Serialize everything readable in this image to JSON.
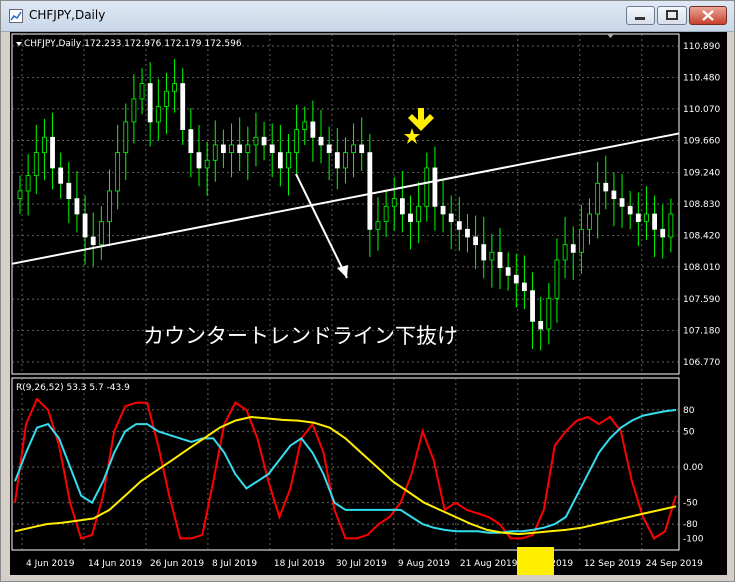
{
  "window": {
    "title": "CHFJPY,Daily",
    "min_icon": "minimize-icon",
    "max_icon": "maximize-icon",
    "close_icon": "close-icon"
  },
  "chart_header": {
    "symbol_line": "CHFJPY,Daily  172.233 172.976 172.179 172.596"
  },
  "annotation": {
    "text": "カウンタートレンドライン下抜け"
  },
  "oscillator": {
    "label": "R(9,26,52) 53.3 5.7 -43.9"
  },
  "colors": {
    "background": "#000000",
    "candle": "#00ff00",
    "trendline": "#ffffff",
    "osc_red": "#ff0000",
    "osc_cyan": "#33ddee",
    "osc_yellow": "#ffee00",
    "marker": "#ffee00"
  },
  "chart_data": [
    {
      "type": "candlestick",
      "title": "CHFJPY,Daily",
      "y_ticks": [
        "110.890",
        "110.480",
        "110.070",
        "109.660",
        "109.240",
        "108.830",
        "108.420",
        "108.010",
        "107.590",
        "107.180",
        "106.770"
      ],
      "ylim": [
        106.77,
        110.89
      ],
      "x_ticks": [
        "4 Jun 2019",
        "14 Jun 2019",
        "26 Jun 2019",
        "8 Jul 2019",
        "18 Jul 2019",
        "30 Jul 2019",
        "9 Aug 2019",
        "21 Aug 2019",
        "2 Sep 2019",
        "12 Sep 2019",
        "24 Sep 2019"
      ],
      "closes": [
        109.0,
        109.2,
        109.5,
        109.7,
        109.3,
        109.1,
        108.9,
        108.7,
        108.4,
        108.3,
        108.6,
        109.0,
        109.5,
        109.9,
        110.2,
        110.4,
        109.9,
        110.1,
        110.3,
        110.4,
        109.8,
        109.5,
        109.3,
        109.4,
        109.6,
        109.5,
        109.6,
        109.5,
        109.6,
        109.7,
        109.6,
        109.5,
        109.3,
        109.5,
        109.8,
        109.9,
        109.7,
        109.6,
        109.5,
        109.3,
        109.5,
        109.6,
        109.5,
        108.5,
        108.6,
        108.8,
        108.9,
        108.7,
        108.6,
        108.8,
        109.3,
        108.8,
        108.7,
        108.6,
        108.5,
        108.4,
        108.3,
        108.1,
        108.2,
        108.0,
        107.9,
        107.8,
        107.7,
        107.3,
        107.2,
        107.6,
        108.1,
        108.3,
        108.2,
        108.5,
        108.7,
        109.1,
        109.0,
        108.9,
        108.8,
        108.7,
        108.6,
        108.7,
        108.5,
        108.4,
        108.7
      ],
      "trendline": {
        "start_price": 108.05,
        "end_price": 109.75
      },
      "annotation": "カウンタートレンドライン下抜け"
    },
    {
      "type": "line",
      "title": "R(9,26,52) 53.3 5.7 -43.9",
      "y_ticks": [
        "80",
        "50",
        "0.00",
        "-50",
        "-80",
        "-100"
      ],
      "ylim": [
        -105,
        105
      ],
      "series": [
        {
          "name": "R9",
          "color": "#ff0000",
          "values": [
            -50,
            60,
            95,
            80,
            30,
            -50,
            -100,
            -95,
            -40,
            50,
            85,
            90,
            90,
            30,
            -40,
            -100,
            -100,
            -95,
            -20,
            60,
            90,
            80,
            40,
            -20,
            -70,
            -30,
            40,
            60,
            20,
            -60,
            -100,
            -100,
            -95,
            -80,
            -70,
            -50,
            -10,
            50,
            10,
            -60,
            -50,
            -60,
            -65,
            -70,
            -80,
            -100,
            -100,
            -95,
            -60,
            30,
            50,
            65,
            70,
            60,
            70,
            50,
            -20,
            -70,
            -100,
            -90,
            -40
          ]
        },
        {
          "name": "R26",
          "color": "#33ddee",
          "values": [
            -20,
            20,
            55,
            60,
            40,
            0,
            -40,
            -50,
            -20,
            20,
            50,
            60,
            60,
            50,
            45,
            40,
            35,
            40,
            40,
            20,
            -10,
            -30,
            -20,
            -10,
            10,
            30,
            40,
            20,
            -10,
            -50,
            -60,
            -60,
            -60,
            -60,
            -60,
            -60,
            -70,
            -80,
            -85,
            -88,
            -90,
            -90,
            -90,
            -92,
            -92,
            -90,
            -90,
            -88,
            -85,
            -80,
            -70,
            -40,
            -10,
            20,
            40,
            55,
            65,
            72,
            75,
            78,
            80
          ]
        },
        {
          "name": "R52",
          "color": "#ffee00",
          "values": [
            -90,
            -85,
            -80,
            -78,
            -75,
            -72,
            -60,
            -40,
            -20,
            -5,
            10,
            25,
            40,
            55,
            65,
            70,
            68,
            66,
            65,
            62,
            55,
            40,
            20,
            0,
            -20,
            -35,
            -50,
            -60,
            -70,
            -80,
            -88,
            -92,
            -94,
            -92,
            -90,
            -88,
            -85,
            -80,
            -75,
            -70,
            -65,
            -60,
            -55
          ]
        }
      ]
    }
  ]
}
